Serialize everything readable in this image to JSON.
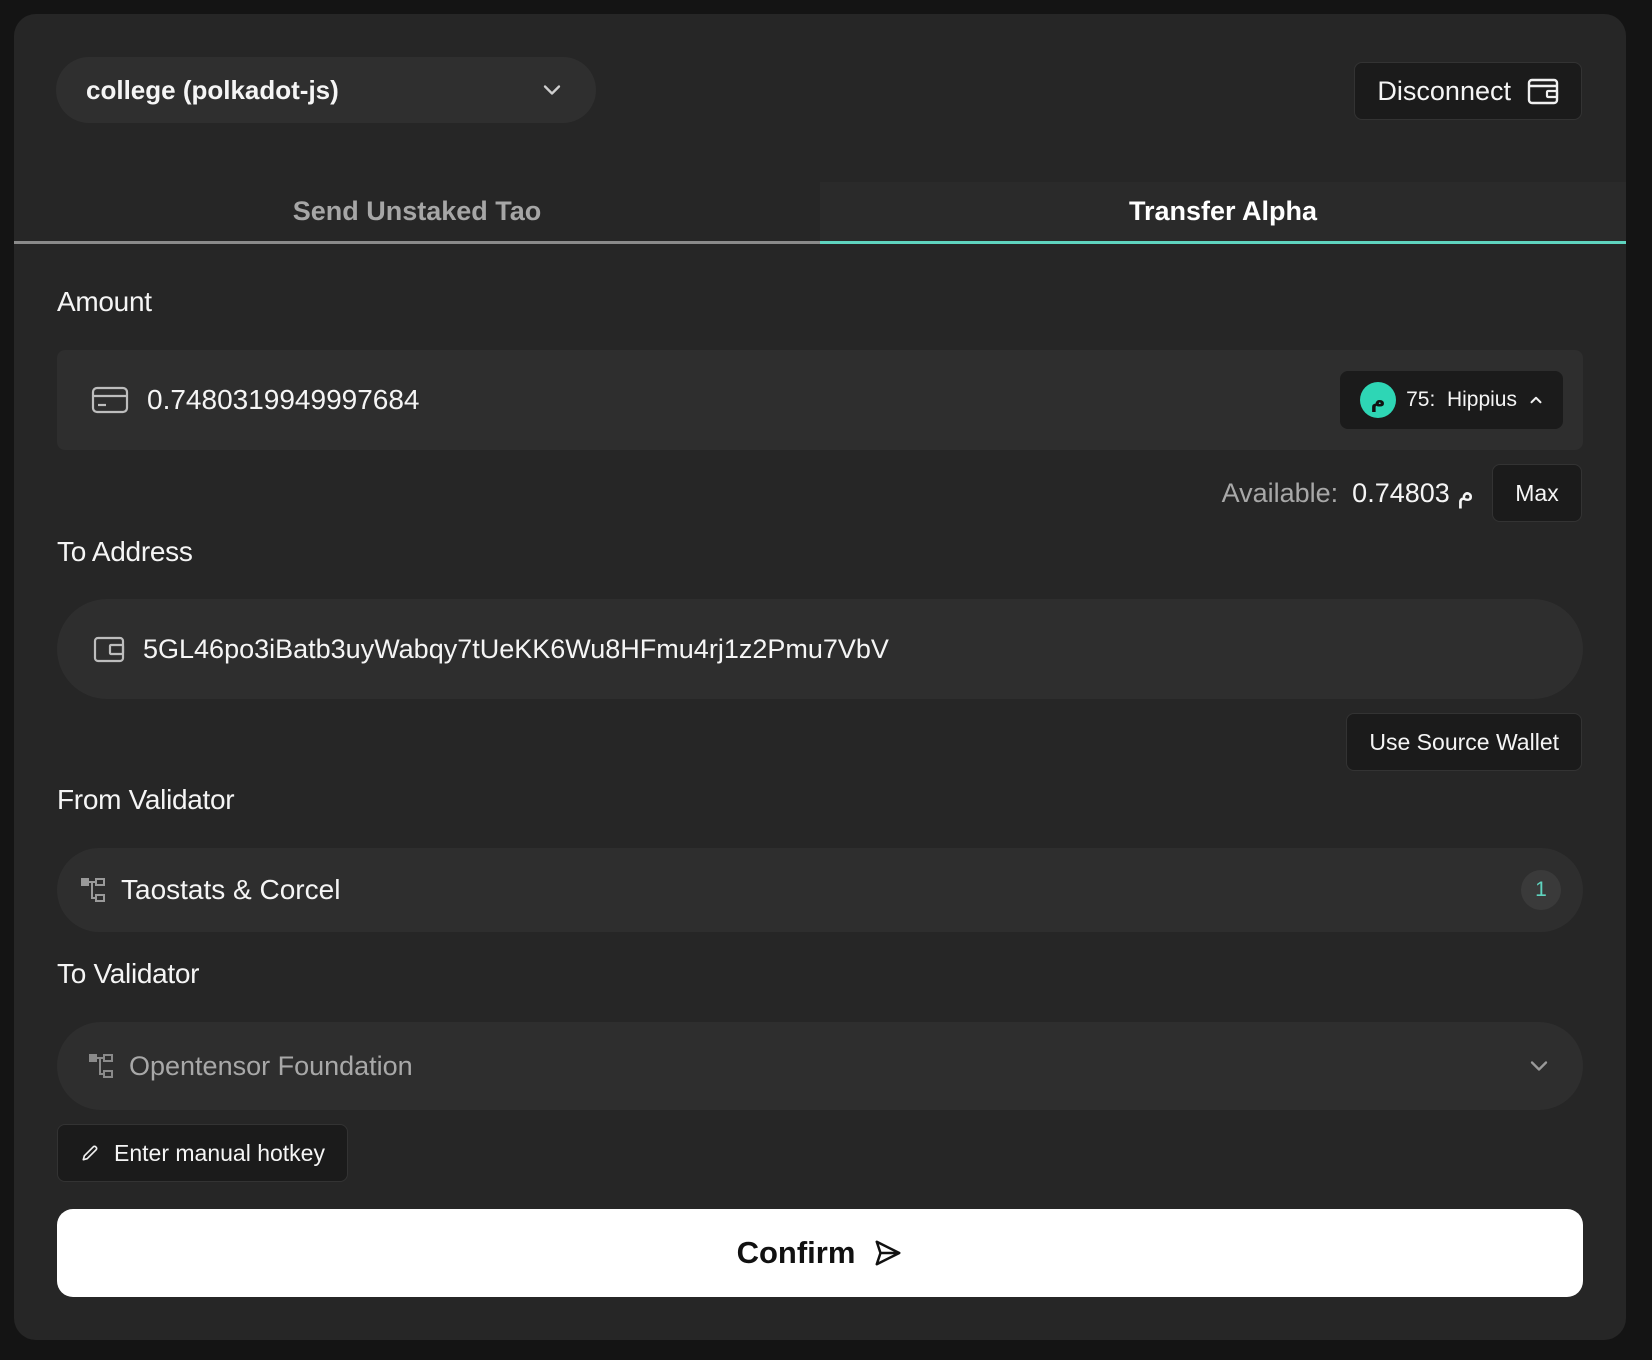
{
  "header": {
    "account_label": "college (polkadot-js)",
    "disconnect_label": "Disconnect"
  },
  "tabs": [
    {
      "label": "Send Unstaked Tao",
      "active": false
    },
    {
      "label": "Transfer Alpha",
      "active": true
    }
  ],
  "amount": {
    "label": "Amount",
    "value": "0.7480319949997684",
    "subnet_symbol": "م",
    "subnet_label": "75:  Hippius",
    "available_label": "Available:",
    "available_value": "م 0.74803",
    "max_label": "Max"
  },
  "to_address": {
    "label": "To Address",
    "value": "5GL46po3iBatb3uyWabqy7tUeKK6Wu8HFmu4rj1z2Pmu7VbV",
    "use_source_label": "Use Source Wallet"
  },
  "from_validator": {
    "label": "From Validator",
    "value": "Taostats & Corcel",
    "count": "1"
  },
  "to_validator": {
    "label": "To Validator",
    "placeholder": "Opentensor Foundation",
    "manual_label": "Enter manual hotkey"
  },
  "confirm_label": "Confirm",
  "colors": {
    "accent": "#5fd4bf",
    "background": "#262626",
    "subnet_badge": "#2ed6b5"
  }
}
